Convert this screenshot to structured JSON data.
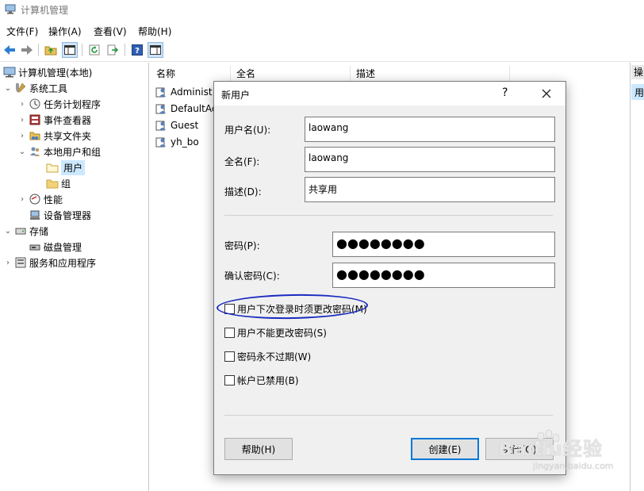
{
  "window": {
    "title": "计算机管理"
  },
  "menu": [
    "文件(F)",
    "操作(A)",
    "查看(V)",
    "帮助(H)"
  ],
  "tree": [
    {
      "label": "计算机管理(本地)",
      "name": "tree-root",
      "icon": "computer-management-icon"
    },
    {
      "label": "系统工具",
      "name": "tree-system-tools",
      "icon": "tools-icon"
    },
    {
      "label": "任务计划程序",
      "name": "tree-task-scheduler",
      "icon": "clock-icon"
    },
    {
      "label": "事件查看器",
      "name": "tree-event-viewer",
      "icon": "event-viewer-icon"
    },
    {
      "label": "共享文件夹",
      "name": "tree-shared-folders",
      "icon": "shared-folder-icon"
    },
    {
      "label": "本地用户和组",
      "name": "tree-local-users-groups",
      "icon": "users-icon"
    },
    {
      "label": "用户",
      "name": "tree-users",
      "icon": "folder-icon"
    },
    {
      "label": "组",
      "name": "tree-groups",
      "icon": "folder-icon"
    },
    {
      "label": "性能",
      "name": "tree-performance",
      "icon": "performance-icon"
    },
    {
      "label": "设备管理器",
      "name": "tree-device-manager",
      "icon": "device-manager-icon"
    },
    {
      "label": "存储",
      "name": "tree-storage",
      "icon": "storage-icon"
    },
    {
      "label": "磁盘管理",
      "name": "tree-disk-management",
      "icon": "disk-icon"
    },
    {
      "label": "服务和应用程序",
      "name": "tree-services-apps",
      "icon": "services-icon"
    }
  ],
  "list": {
    "columns": [
      "名称",
      "全名",
      "描述"
    ],
    "rows": [
      "Administ",
      "DefaultAc",
      "Guest",
      "yh_bo"
    ]
  },
  "actions": {
    "header": "操",
    "item": "用"
  },
  "dialog": {
    "title": "新用户",
    "help": "?",
    "username_label": "用户名(U):",
    "username_value": "laowang",
    "fullname_label": "全名(F):",
    "fullname_value": "laowang",
    "description_label": "描述(D):",
    "description_value": "共享用",
    "password_label": "密码(P):",
    "password_value": "●●●●●●●●",
    "confirm_label": "确认密码(C):",
    "confirm_value": "●●●●●●●●",
    "options": [
      {
        "label": "用户下次登录时须更改密码(M)",
        "checked": false
      },
      {
        "label": "用户不能更改密码(S)",
        "checked": false
      },
      {
        "label": "密码永不过期(W)",
        "checked": false
      },
      {
        "label": "帐户已禁用(B)",
        "checked": false
      }
    ],
    "help_button": "帮助(H)",
    "create_button": "创建(E)",
    "close_button": "关闭(O)"
  },
  "watermark": {
    "main": "Baidu经验",
    "sub": "jingyan.baidu.com"
  }
}
